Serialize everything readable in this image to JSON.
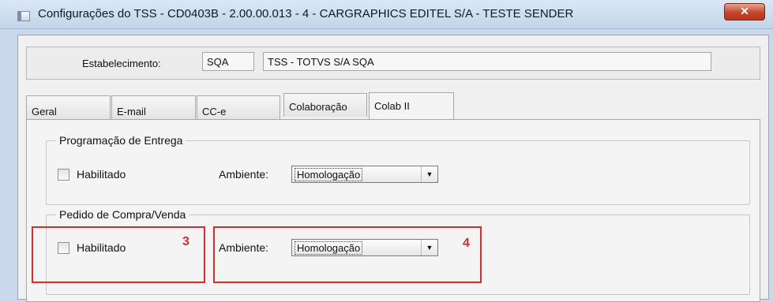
{
  "window": {
    "title": "Configurações do TSS - CD0403B - 2.00.00.013 - 4 - CARGRAPHICS EDITEL S/A - TESTE SENDER",
    "close_glyph": "✕"
  },
  "estabelecimento": {
    "label": "Estabelecimento:",
    "code": "SQA",
    "name": "TSS - TOTVS S/A SQA"
  },
  "tabs": [
    {
      "label": "Geral"
    },
    {
      "label": "E-mail"
    },
    {
      "label": "CC-e"
    },
    {
      "label": "Colaboração"
    },
    {
      "label": "Colab II"
    }
  ],
  "active_tab": "Colab II",
  "groups": {
    "programacao": {
      "title": "Programação de Entrega",
      "checkbox_label": "Habilitado",
      "ambiente_label": "Ambiente:",
      "ambiente_value": "Homologação"
    },
    "pedido": {
      "title": "Pedido de Compra/Venda",
      "checkbox_label": "Habilitado",
      "ambiente_label": "Ambiente:",
      "ambiente_value": "Homologação"
    }
  },
  "annotations": {
    "marker_3": "3",
    "marker_4": "4",
    "color": "#dd2b2b"
  }
}
